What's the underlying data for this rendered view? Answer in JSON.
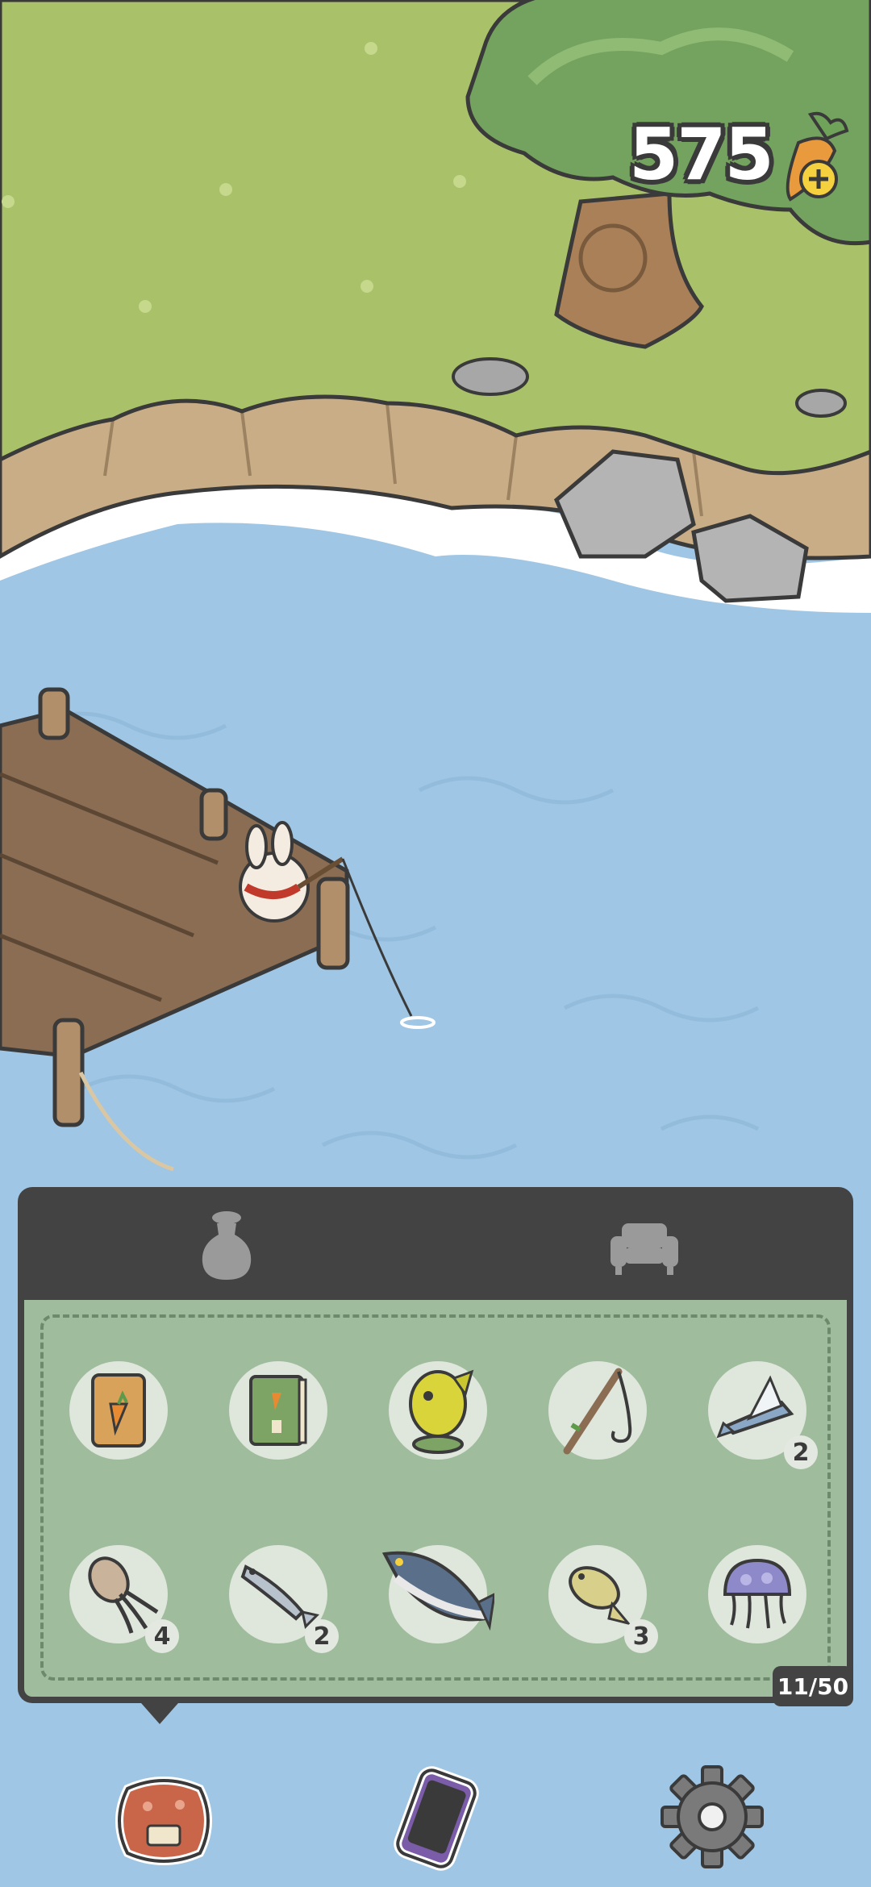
{
  "hud": {
    "carrot_count": "575",
    "carrot_icon": "carrot-plus-icon"
  },
  "inventory": {
    "tabs": [
      {
        "name": "tab-bag",
        "icon": "bag-icon",
        "selected": true
      },
      {
        "name": "tab-furniture",
        "icon": "sofa-icon",
        "selected": false
      }
    ],
    "items": [
      {
        "icon": "carrot-seed-packet-icon",
        "quantity": ""
      },
      {
        "icon": "recipe-book-icon",
        "quantity": ""
      },
      {
        "icon": "yellow-fish-trophy-icon",
        "quantity": ""
      },
      {
        "icon": "fishing-rod-icon",
        "quantity": ""
      },
      {
        "icon": "flying-fish-icon",
        "quantity": "2"
      },
      {
        "icon": "squid-icon",
        "quantity": "4"
      },
      {
        "icon": "sardine-icon",
        "quantity": "2"
      },
      {
        "icon": "tuna-icon",
        "quantity": ""
      },
      {
        "icon": "small-fish-icon",
        "quantity": "3"
      },
      {
        "icon": "jellyfish-icon",
        "quantity": ""
      }
    ],
    "capacity": "11/50"
  },
  "bottom_nav": [
    {
      "icon": "carrot-bag-icon"
    },
    {
      "icon": "phone-icon"
    },
    {
      "icon": "settings-gear-icon"
    }
  ],
  "colors": {
    "grass": "#a9c26a",
    "water": "#9fc6e4",
    "panel_dark": "#434343",
    "panel_green": "#9fbd9c"
  }
}
